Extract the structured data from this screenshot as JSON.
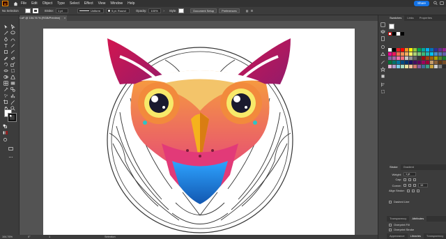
{
  "app": {
    "logo": "Ai",
    "colors": {
      "accent": "#1473e6",
      "logo": "#ff9a00"
    }
  },
  "menubar": {
    "items": [
      "File",
      "Edit",
      "Object",
      "Type",
      "Select",
      "Effect",
      "View",
      "Window",
      "Help"
    ],
    "share_label": "Share"
  },
  "control": {
    "selection": "No Selection",
    "stroke_label": "Stroke:",
    "stroke_weight": "1 pt",
    "profile": "Uniform",
    "brush": "5 pt. Round",
    "opacity_label": "Opacity:",
    "opacity": "100%",
    "style_label": "Style:",
    "doc_setup": "Document Setup",
    "preferences": "Preferences"
  },
  "document": {
    "tab_title": "47 Art.ai* @ 104.76 % (RGB/Preview)",
    "close": "×"
  },
  "panel": {
    "tabs": [
      "Swatches",
      "Links",
      "Properties"
    ],
    "stroke_tabs": [
      "Stroke",
      "Gradient"
    ],
    "weight_label": "Weight:",
    "weight_value": "1 pt",
    "cap_label": "Cap:",
    "corner_label": "Corner:",
    "limit_value": "10",
    "align_label": "Align Stroke:",
    "dashed_label": "Dashed Line",
    "bottom_tabs": [
      "Transparency",
      "Appearance"
    ],
    "attributes_tab": "Attributes",
    "overprint_fill": "Overprint Fill",
    "overprint_stroke": "Overprint Stroke",
    "footer_tabs": [
      "Appearance",
      "Libraries",
      "Transparency"
    ]
  },
  "status": {
    "zoom": "104.76%",
    "rotation": "0°",
    "page": "1",
    "mode": "Selection"
  },
  "swatch_colors": [
    "#ffffff",
    "#000000",
    "#ed1c24",
    "#ff0000",
    "#f7941d",
    "#fff200",
    "#8dc63f",
    "#00a651",
    "#00a99d",
    "#00aeef",
    "#0072bc",
    "#2e3192",
    "#662d91",
    "#92278f",
    "#ec008c",
    "#ed145b",
    "#f26c4f",
    "#f68e56",
    "#fbaf5d",
    "#fff568",
    "#acd373",
    "#7cc576",
    "#3cb878",
    "#1cbbb4",
    "#00bff3",
    "#448ccb",
    "#5674b9",
    "#605ca8",
    "#8560a8",
    "#a864a8",
    "#f06eaa",
    "#f26d7d",
    "#c6c6c6",
    "#959595",
    "#636363",
    "#363636",
    "#9e0b0f",
    "#a0410d",
    "#a36209",
    "#aba000",
    "#598527",
    "#197b30",
    "#007236",
    "#00746b",
    "#0076a3",
    "#004a80",
    "#003471",
    "#1b1464",
    "#440e62",
    "#630460",
    "#9e005d",
    "#9e0039",
    "#c69c6d",
    "#8c6239",
    "#603913",
    "#754c24",
    "#e3b5d3",
    "#b5a0d0",
    "#7fd0e8",
    "#a6dcc3",
    "#e8e2a0",
    "#f2c29b",
    "#d57870",
    "#8c5d9e",
    "#3f6e9d",
    "#3f9d86",
    "#c8a23c",
    "#d0d0d0",
    "#7a7a7a",
    "#2b2b2b"
  ]
}
